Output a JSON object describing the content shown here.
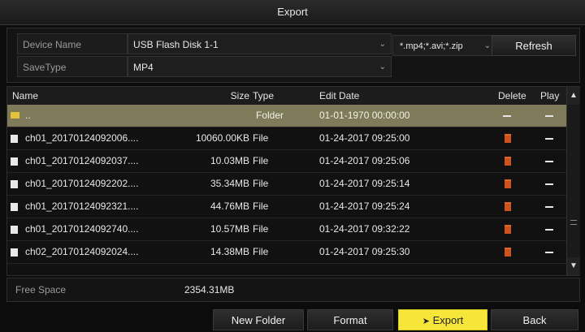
{
  "window": {
    "title": "Export"
  },
  "device": {
    "name_label": "Device Name",
    "name_value": "USB Flash Disk 1-1",
    "savetype_label": "SaveType",
    "savetype_value": "MP4",
    "ext_filter": "*.mp4;*.avi;*.zip",
    "refresh_label": "Refresh"
  },
  "table": {
    "headers": {
      "name": "Name",
      "size": "Size",
      "type": "Type",
      "edit_date": "Edit Date",
      "delete": "Delete",
      "play": "Play"
    },
    "rows": [
      {
        "name": "..",
        "size": "",
        "type": "Folder",
        "date": "01-01-1970 00:00:00",
        "kind": "folder",
        "selected": true
      },
      {
        "name": "ch01_20170124092006....",
        "size": "10060.00KB",
        "type": "File",
        "date": "01-24-2017 09:25:00",
        "kind": "file"
      },
      {
        "name": "ch01_20170124092037....",
        "size": "10.03MB",
        "type": "File",
        "date": "01-24-2017 09:25:06",
        "kind": "file"
      },
      {
        "name": "ch01_20170124092202....",
        "size": "35.34MB",
        "type": "File",
        "date": "01-24-2017 09:25:14",
        "kind": "file"
      },
      {
        "name": "ch01_20170124092321....",
        "size": "44.76MB",
        "type": "File",
        "date": "01-24-2017 09:25:24",
        "kind": "file"
      },
      {
        "name": "ch01_20170124092740....",
        "size": "10.57MB",
        "type": "File",
        "date": "01-24-2017 09:32:22",
        "kind": "file"
      },
      {
        "name": "ch02_20170124092024....",
        "size": "14.38MB",
        "type": "File",
        "date": "01-24-2017 09:25:30",
        "kind": "file"
      }
    ]
  },
  "footer": {
    "free_space_label": "Free Space",
    "free_space_value": "2354.31MB",
    "new_folder_label": "New Folder",
    "format_label": "Format",
    "export_label": "Export",
    "back_label": "Back"
  },
  "colors": {
    "accent": "#f6e63a",
    "selected_row": "#7e7a5a",
    "delete_icon": "#d0531d",
    "folder_icon": "#e4c53a"
  }
}
